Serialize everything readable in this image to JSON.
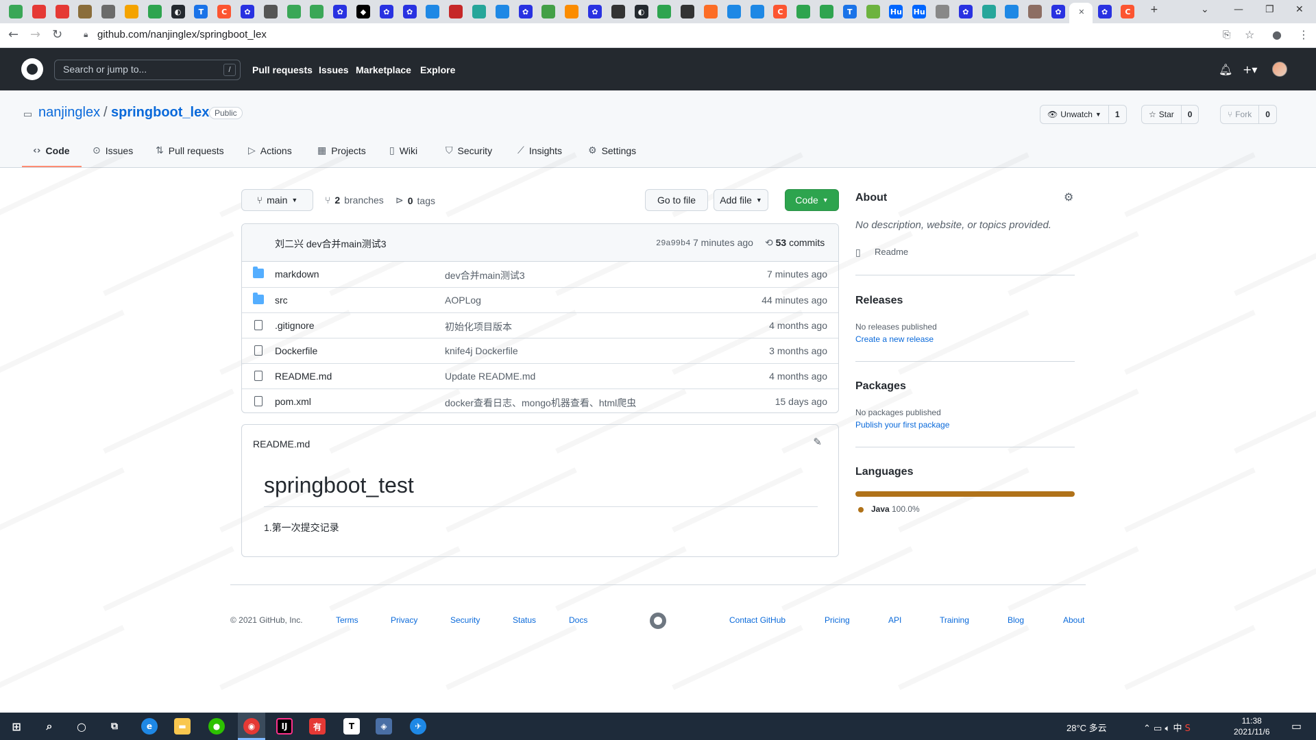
{
  "browser": {
    "tabs": [
      {
        "icon": "green-circle-icon",
        "color": "#3aa757"
      },
      {
        "icon": "red-g-icon",
        "color": "#e53935"
      },
      {
        "icon": "red-g-icon",
        "color": "#e53935"
      },
      {
        "icon": "bamboo-icon",
        "color": "#8a6d3b"
      },
      {
        "icon": "pencil-icon",
        "color": "#6b6b6b"
      },
      {
        "icon": "arrow-icon",
        "color": "#f4a300"
      },
      {
        "icon": "green-dot-icon",
        "color": "#2ea44f"
      },
      {
        "icon": "github-icon",
        "color": "#24292f"
      },
      {
        "icon": "typora-icon",
        "color": "#1a73e8"
      },
      {
        "icon": "csdn-icon",
        "color": "#fc5531"
      },
      {
        "icon": "baidu-paw-icon",
        "color": "#2932e1"
      },
      {
        "icon": "link-icon",
        "color": "#555555"
      },
      {
        "icon": "green-circle-icon",
        "color": "#3aa757"
      },
      {
        "icon": "green-circle-icon",
        "color": "#3aa757"
      },
      {
        "icon": "baidu-paw-icon",
        "color": "#2932e1"
      },
      {
        "icon": "juejin-icon",
        "color": "#000000"
      },
      {
        "icon": "baidu-paw-icon",
        "color": "#2932e1"
      },
      {
        "icon": "baidu-paw-icon",
        "color": "#2932e1"
      },
      {
        "icon": "globe-icon",
        "color": "#1e88e5"
      },
      {
        "icon": "game-icon",
        "color": "#c62828"
      },
      {
        "icon": "leaf-icon",
        "color": "#26a69a"
      },
      {
        "icon": "cube-icon",
        "color": "#1e88e5"
      },
      {
        "icon": "baidu-paw-icon",
        "color": "#2932e1"
      },
      {
        "icon": "chat-icon",
        "color": "#43a047"
      },
      {
        "icon": "orange-circle-icon",
        "color": "#fb8c00"
      },
      {
        "icon": "baidu-paw-icon",
        "color": "#2932e1"
      },
      {
        "icon": "dark-circle-icon",
        "color": "#333333"
      },
      {
        "icon": "github-icon",
        "color": "#24292f"
      },
      {
        "icon": "green-dot-icon",
        "color": "#2ea44f"
      },
      {
        "icon": "dark-circle-icon",
        "color": "#333333"
      },
      {
        "icon": "gitlab-icon",
        "color": "#fc6d26"
      },
      {
        "icon": "globe-icon",
        "color": "#1e88e5"
      },
      {
        "icon": "globe-icon",
        "color": "#1e88e5"
      },
      {
        "icon": "csdn-icon",
        "color": "#fc5531"
      },
      {
        "icon": "green-dot-icon",
        "color": "#2ea44f"
      },
      {
        "icon": "green-dot-icon",
        "color": "#2ea44f"
      },
      {
        "icon": "typora-icon",
        "color": "#1a73e8"
      },
      {
        "icon": "spring-icon",
        "color": "#6db33f"
      },
      {
        "icon": "hu-icon",
        "color": "#0066ff"
      },
      {
        "icon": "hu-icon",
        "color": "#0066ff"
      },
      {
        "icon": "bottle-icon",
        "color": "#888888"
      },
      {
        "icon": "baidu-paw-icon",
        "color": "#2932e1"
      },
      {
        "icon": "leaf-icon",
        "color": "#26a69a"
      },
      {
        "icon": "cube-icon",
        "color": "#1e88e5"
      },
      {
        "icon": "person-icon",
        "color": "#8d6e63"
      },
      {
        "icon": "baidu-paw-icon",
        "color": "#2932e1"
      },
      {
        "icon": "close-icon",
        "color": "#5f6368"
      },
      {
        "icon": "baidu-paw-icon",
        "color": "#2932e1"
      },
      {
        "icon": "csdn-icon",
        "color": "#fc5531"
      }
    ],
    "url": "github.com/nanjinglex/springboot_lex"
  },
  "header": {
    "search_placeholder": "Search or jump to...",
    "search_shortcut": "/",
    "nav": [
      "Pull requests",
      "Issues",
      "Marketplace",
      "Explore"
    ]
  },
  "repo": {
    "owner": "nanjinglex",
    "separator": "/",
    "name": "springboot_lex",
    "visibility": "Public",
    "watch": {
      "label": "Unwatch",
      "count": "1"
    },
    "star": {
      "label": "Star",
      "count": "0"
    },
    "fork": {
      "label": "Fork",
      "count": "0"
    },
    "tabs": [
      {
        "label": "Code",
        "icon": "code-icon"
      },
      {
        "label": "Issues",
        "icon": "issue-icon"
      },
      {
        "label": "Pull requests",
        "icon": "pull-request-icon"
      },
      {
        "label": "Actions",
        "icon": "play-icon"
      },
      {
        "label": "Projects",
        "icon": "project-icon"
      },
      {
        "label": "Wiki",
        "icon": "book-icon"
      },
      {
        "label": "Security",
        "icon": "shield-icon"
      },
      {
        "label": "Insights",
        "icon": "graph-icon"
      },
      {
        "label": "Settings",
        "icon": "gear-icon"
      }
    ]
  },
  "controls": {
    "branch": "main",
    "branches_count": "2",
    "branches_label": "branches",
    "tags_count": "0",
    "tags_label": "tags",
    "goto_file": "Go to file",
    "add_file": "Add file",
    "code": "Code"
  },
  "commit": {
    "author_message": "刘二兴 dev合并main测试3",
    "sha": "29a99b4",
    "time": "7 minutes ago",
    "count": "53",
    "count_label": "commits"
  },
  "files": [
    {
      "type": "folder",
      "name": "markdown",
      "message": "dev合并main测试3",
      "age": "7 minutes ago"
    },
    {
      "type": "folder",
      "name": "src",
      "message": "AOPLog",
      "age": "44 minutes ago"
    },
    {
      "type": "file",
      "name": ".gitignore",
      "message": "初始化项目版本",
      "age": "4 months ago"
    },
    {
      "type": "file",
      "name": "Dockerfile",
      "message": "knife4j Dockerfile",
      "age": "3 months ago"
    },
    {
      "type": "file",
      "name": "README.md",
      "message": "Update README.md",
      "age": "4 months ago"
    },
    {
      "type": "file",
      "name": "pom.xml",
      "message": "docker查看日志、mongo机器查看、html爬虫",
      "age": "15 days ago"
    }
  ],
  "readme": {
    "filename": "README.md",
    "heading": "springboot_test",
    "body": "1.第一次提交记录"
  },
  "about": {
    "title": "About",
    "description": "No description, website, or topics provided.",
    "readme": "Readme",
    "releases_title": "Releases",
    "releases_text": "No releases published",
    "releases_link": "Create a new release",
    "packages_title": "Packages",
    "packages_text": "No packages published",
    "packages_link": "Publish your first package",
    "languages_title": "Languages",
    "language_name": "Java",
    "language_pct": "100.0%",
    "language_color": "#b07219"
  },
  "footer": {
    "copyright": "© 2021 GitHub, Inc.",
    "links_left": [
      "Terms",
      "Privacy",
      "Security",
      "Status",
      "Docs"
    ],
    "links_right": [
      "Contact GitHub",
      "Pricing",
      "API",
      "Training",
      "Blog",
      "About"
    ]
  },
  "taskbar": {
    "weather": "28°C 多云",
    "ime": "中",
    "time": "11:38",
    "date": "2021/11/6"
  }
}
